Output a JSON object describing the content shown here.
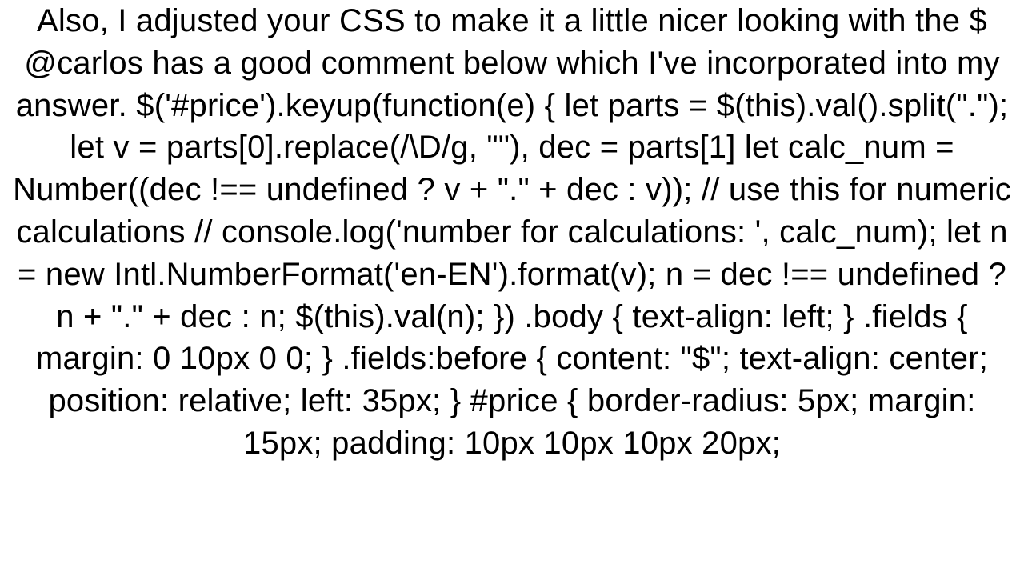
{
  "body_text": "Also, I adjusted your CSS to make it a little nicer looking with the $ @carlos has a good comment below which I've incorporated into my answer.   $('#price').keyup(function(e) {     let parts = $(this).val().split(\".\");     let v = parts[0].replace(/\\D/g, \"\"),       dec = parts[1]     let calc_num = Number((dec !== undefined ? v + \".\" + dec : v));     // use this for numeric calculations     // console.log('number for calculations: ', calc_num);     let n = new Intl.NumberFormat('en-EN').format(v);     n = dec !== undefined ? n + \".\" + dec : n;     $(this).val(n);   })  .body {   text-align: left; }  .fields {   margin: 0 10px 0 0; }  .fields:before {   content: \"$\";   text-align: center;   position: relative;   left: 35px; }  #price {   border-radius: 5px;   margin: 15px;   padding: 10px 10px 10px 20px;"
}
